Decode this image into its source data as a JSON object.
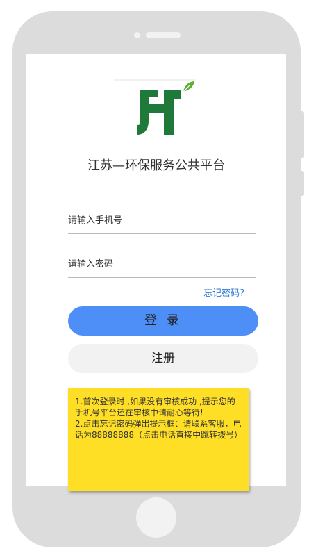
{
  "app": {
    "platform_title": "江苏—环保服务公共平台"
  },
  "login_form": {
    "phone_placeholder": "请输入手机号",
    "password_placeholder": "请输入密码",
    "forgot_password_label": "忘记密码?",
    "login_label": "登 录",
    "register_label": "注册"
  },
  "annotation_note": {
    "line1": "1.首次登录时 ,如果没有审核成功 ,提示您的手机号平台还在审核中请耐心等待!",
    "line2": "2.点击忘记密码弹出提示框：请联系客服，电话为88888888（点击电话直接中跳转拨号）"
  },
  "colors": {
    "brand_green": "#1f7a3a",
    "leaf_green": "#5bb135",
    "login_button": "#4d8ef7",
    "register_button": "#f2f2f2",
    "link_blue": "#2b7bd1",
    "note_yellow": "#ffdf25",
    "device_frame": "#dcdcdc"
  },
  "icons": {
    "logo": "ht-leaf-logo"
  }
}
